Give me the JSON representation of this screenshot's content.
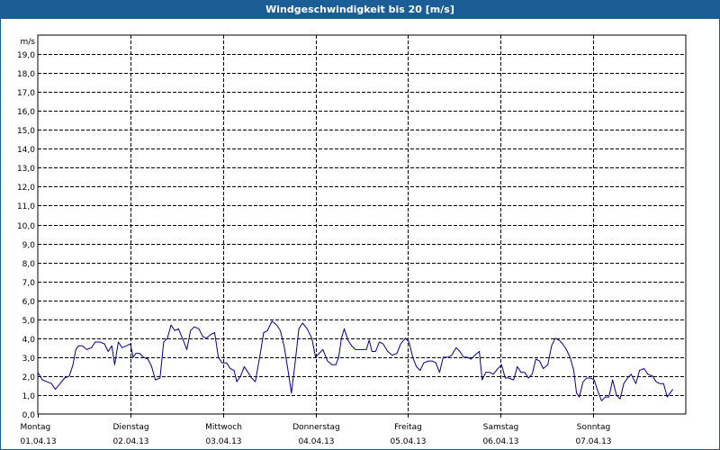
{
  "window": {
    "title": "Windgeschwindigkeit bis 20 [m/s]"
  },
  "colors": {
    "line": "#00008b",
    "titlebar": "#1b5d95",
    "grid": "#000000"
  },
  "chart_data": {
    "type": "line",
    "title": "Windgeschwindigkeit bis 20 [m/s]",
    "ylabel": "m/s",
    "ylim": [
      0,
      20
    ],
    "yticks": [
      "0,0",
      "1,0",
      "2,0",
      "3,0",
      "4,0",
      "5,0",
      "6,0",
      "7,0",
      "8,0",
      "9,0",
      "10,0",
      "11,0",
      "12,0",
      "13,0",
      "14,0",
      "15,0",
      "16,0",
      "17,0",
      "18,0",
      "19,0"
    ],
    "days": [
      {
        "weekday": "Montag",
        "date": "01.04.13"
      },
      {
        "weekday": "Dienstag",
        "date": "02.04.13"
      },
      {
        "weekday": "Mittwoch",
        "date": "03.04.13"
      },
      {
        "weekday": "Donnerstag",
        "date": "04.04.13"
      },
      {
        "weekday": "Freitag",
        "date": "05.04.13"
      },
      {
        "weekday": "Samstag",
        "date": "06.04.13"
      },
      {
        "weekday": "Sonntag",
        "date": "07.04.13"
      }
    ],
    "x_unit": "day offset from 01.04.13 00:00",
    "grid": true,
    "series": [
      {
        "values": [
          [
            0.0,
            2.2
          ],
          [
            0.05,
            1.8
          ],
          [
            0.1,
            1.7
          ],
          [
            0.15,
            1.6
          ],
          [
            0.19,
            1.3
          ],
          [
            0.24,
            1.6
          ],
          [
            0.29,
            1.9
          ],
          [
            0.34,
            2.0
          ],
          [
            0.38,
            2.6
          ],
          [
            0.41,
            3.4
          ],
          [
            0.44,
            3.6
          ],
          [
            0.48,
            3.6
          ],
          [
            0.53,
            3.4
          ],
          [
            0.58,
            3.5
          ],
          [
            0.62,
            3.8
          ],
          [
            0.67,
            3.8
          ],
          [
            0.72,
            3.7
          ],
          [
            0.76,
            3.3
          ],
          [
            0.8,
            3.6
          ],
          [
            0.83,
            2.6
          ],
          [
            0.87,
            3.8
          ],
          [
            0.91,
            3.5
          ],
          [
            0.96,
            3.6
          ],
          [
            1.0,
            3.7
          ],
          [
            1.03,
            3.0
          ],
          [
            1.06,
            3.2
          ],
          [
            1.1,
            3.2
          ],
          [
            1.14,
            3.0
          ],
          [
            1.19,
            2.9
          ],
          [
            1.23,
            2.5
          ],
          [
            1.27,
            1.8
          ],
          [
            1.32,
            1.9
          ],
          [
            1.36,
            3.8
          ],
          [
            1.4,
            4.0
          ],
          [
            1.44,
            4.7
          ],
          [
            1.48,
            4.4
          ],
          [
            1.52,
            4.5
          ],
          [
            1.57,
            3.9
          ],
          [
            1.61,
            3.4
          ],
          [
            1.65,
            4.4
          ],
          [
            1.69,
            4.6
          ],
          [
            1.74,
            4.5
          ],
          [
            1.78,
            4.1
          ],
          [
            1.82,
            4.0
          ],
          [
            1.87,
            4.2
          ],
          [
            1.91,
            4.3
          ],
          [
            1.95,
            3.0
          ],
          [
            1.99,
            2.7
          ],
          [
            2.04,
            2.7
          ],
          [
            2.08,
            2.4
          ],
          [
            2.12,
            2.3
          ],
          [
            2.15,
            1.7
          ],
          [
            2.19,
            2.0
          ],
          [
            2.23,
            2.5
          ],
          [
            2.27,
            2.2
          ],
          [
            2.31,
            1.9
          ],
          [
            2.35,
            1.7
          ],
          [
            2.4,
            3.1
          ],
          [
            2.44,
            4.3
          ],
          [
            2.48,
            4.4
          ],
          [
            2.53,
            4.9
          ],
          [
            2.58,
            4.7
          ],
          [
            2.62,
            4.4
          ],
          [
            2.66,
            3.6
          ],
          [
            2.7,
            2.4
          ],
          [
            2.74,
            1.1
          ],
          [
            2.78,
            2.7
          ],
          [
            2.82,
            4.5
          ],
          [
            2.86,
            4.8
          ],
          [
            2.91,
            4.5
          ],
          [
            2.96,
            4.0
          ],
          [
            3.0,
            3.0
          ],
          [
            3.04,
            3.2
          ],
          [
            3.08,
            3.4
          ],
          [
            3.13,
            2.8
          ],
          [
            3.18,
            2.6
          ],
          [
            3.22,
            2.6
          ],
          [
            3.25,
            3.0
          ],
          [
            3.28,
            4.0
          ],
          [
            3.31,
            4.5
          ],
          [
            3.35,
            3.9
          ],
          [
            3.39,
            3.6
          ],
          [
            3.43,
            3.4
          ],
          [
            3.47,
            3.4
          ],
          [
            3.51,
            3.4
          ],
          [
            3.55,
            3.4
          ],
          [
            3.58,
            3.9
          ],
          [
            3.61,
            3.3
          ],
          [
            3.65,
            3.3
          ],
          [
            3.69,
            3.8
          ],
          [
            3.73,
            3.7
          ],
          [
            3.78,
            3.3
          ],
          [
            3.83,
            3.1
          ],
          [
            3.88,
            3.2
          ],
          [
            3.92,
            3.7
          ],
          [
            3.97,
            4.0
          ],
          [
            4.01,
            3.8
          ],
          [
            4.05,
            3.0
          ],
          [
            4.09,
            2.5
          ],
          [
            4.13,
            2.3
          ],
          [
            4.17,
            2.7
          ],
          [
            4.22,
            2.8
          ],
          [
            4.26,
            2.8
          ],
          [
            4.3,
            2.7
          ],
          [
            4.34,
            2.2
          ],
          [
            4.38,
            3.0
          ],
          [
            4.43,
            3.0
          ],
          [
            4.47,
            3.1
          ],
          [
            4.52,
            3.5
          ],
          [
            4.56,
            3.3
          ],
          [
            4.6,
            3.0
          ],
          [
            4.64,
            3.0
          ],
          [
            4.68,
            2.9
          ],
          [
            4.72,
            3.1
          ],
          [
            4.77,
            3.3
          ],
          [
            4.8,
            1.8
          ],
          [
            4.84,
            2.2
          ],
          [
            4.88,
            2.2
          ],
          [
            4.92,
            2.1
          ],
          [
            4.97,
            2.4
          ],
          [
            5.01,
            2.6
          ],
          [
            5.05,
            1.9
          ],
          [
            5.09,
            1.9
          ],
          [
            5.14,
            1.8
          ],
          [
            5.18,
            2.5
          ],
          [
            5.22,
            2.2
          ],
          [
            5.26,
            2.2
          ],
          [
            5.3,
            1.9
          ],
          [
            5.34,
            2.1
          ],
          [
            5.38,
            2.9
          ],
          [
            5.42,
            2.8
          ],
          [
            5.46,
            2.4
          ],
          [
            5.51,
            2.6
          ],
          [
            5.55,
            3.6
          ],
          [
            5.59,
            4.0
          ],
          [
            5.63,
            3.9
          ],
          [
            5.67,
            3.7
          ],
          [
            5.71,
            3.4
          ],
          [
            5.75,
            3.0
          ],
          [
            5.79,
            2.3
          ],
          [
            5.82,
            1.1
          ],
          [
            5.85,
            0.9
          ],
          [
            5.89,
            1.7
          ],
          [
            5.93,
            1.9
          ],
          [
            5.97,
            1.9
          ],
          [
            6.01,
            1.8
          ],
          [
            6.05,
            1.2
          ],
          [
            6.09,
            0.7
          ],
          [
            6.13,
            0.9
          ],
          [
            6.17,
            0.9
          ],
          [
            6.21,
            1.8
          ],
          [
            6.25,
            1.0
          ],
          [
            6.29,
            0.8
          ],
          [
            6.33,
            1.6
          ],
          [
            6.37,
            1.9
          ],
          [
            6.41,
            2.1
          ],
          [
            6.46,
            1.6
          ],
          [
            6.5,
            2.3
          ],
          [
            6.55,
            2.4
          ],
          [
            6.59,
            2.1
          ],
          [
            6.64,
            2.0
          ],
          [
            6.68,
            1.7
          ],
          [
            6.72,
            1.6
          ],
          [
            6.76,
            1.6
          ],
          [
            6.8,
            0.9
          ],
          [
            6.86,
            1.3
          ]
        ]
      }
    ]
  }
}
